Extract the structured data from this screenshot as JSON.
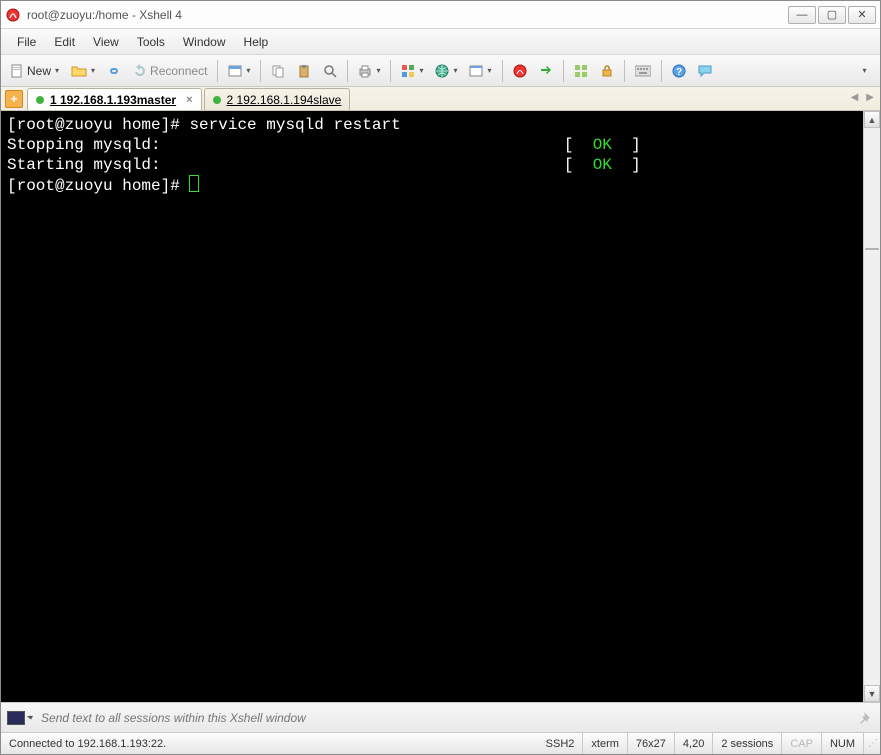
{
  "window": {
    "title": "root@zuoyu:/home - Xshell 4"
  },
  "menu": {
    "file": "File",
    "edit": "Edit",
    "view": "View",
    "tools": "Tools",
    "window": "Window",
    "help": "Help"
  },
  "toolbar": {
    "new": "New",
    "reconnect": "Reconnect"
  },
  "tabs": {
    "t1": {
      "label": "1 192.168.1.193master"
    },
    "t2": {
      "label": "2 192.168.1.194slave"
    }
  },
  "terminal": {
    "prompt1": "[root@zuoyu home]# ",
    "cmd": "service mysqld restart",
    "line2_left": "Stopping mysqld:",
    "line3_left": "Starting mysqld:",
    "bracket_l": "[  ",
    "ok": "OK",
    "bracket_r": "  ]",
    "prompt2": "[root@zuoyu home]# "
  },
  "compose": {
    "placeholder": "Send text to all sessions within this Xshell window"
  },
  "status": {
    "conn": "Connected to 192.168.1.193:22.",
    "proto": "SSH2",
    "term": "xterm",
    "size": "76x27",
    "cursor": "4,20",
    "sessions": "2 sessions",
    "cap": "CAP",
    "num": "NUM"
  }
}
